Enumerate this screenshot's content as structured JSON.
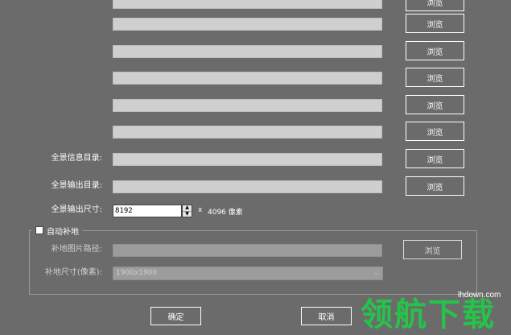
{
  "rows": [
    {
      "label": "",
      "browse": "浏览"
    },
    {
      "label": "",
      "browse": "浏览"
    },
    {
      "label": "",
      "browse": "浏览"
    },
    {
      "label": "",
      "browse": "浏览"
    },
    {
      "label": "",
      "browse": "浏览"
    },
    {
      "label": "",
      "browse": "浏览"
    },
    {
      "label": "全景信息目录:",
      "browse": "浏览"
    },
    {
      "label": "全景输出目录:",
      "browse": "浏览"
    }
  ],
  "output_size": {
    "label": "全景输出尺寸:",
    "value": "8192",
    "separator": "x",
    "height_text": "4096 像素"
  },
  "patch_group": {
    "title": "自动补地",
    "checked": false,
    "path_label": "补地图片路径:",
    "browse": "浏览",
    "size_label": "补地尺寸(像素):",
    "size_selected": "1900x1900"
  },
  "footer": {
    "ok": "确定",
    "cancel": "取消"
  },
  "watermark": {
    "brand": "领航下载",
    "url": "lhdown.com"
  },
  "colors": {
    "background": "#6b6b6b",
    "field": "#cfcfcf",
    "watermark_green": "#26c24a"
  }
}
